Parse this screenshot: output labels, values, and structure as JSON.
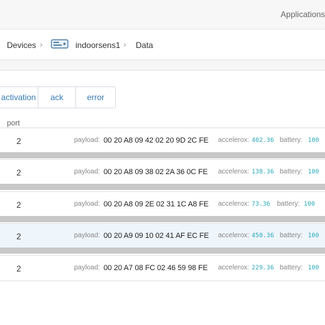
{
  "header": {
    "applications_label": "Applications"
  },
  "breadcrumb": {
    "devices": "Devices",
    "sep1": "›",
    "device": "indoorsens1",
    "sep2": "›",
    "data": "Data"
  },
  "tabs": [
    {
      "label": "activation"
    },
    {
      "label": "ack"
    },
    {
      "label": "error"
    }
  ],
  "table": {
    "port_header": "port",
    "payload_label": "payload:",
    "accelerox_label": "accelerox:",
    "battery_label": "battery:",
    "rows": [
      {
        "port": "2",
        "payload": "00 20 A8 09 42 02 20 9D 2C FE",
        "accelerox": "402.36",
        "battery": "100"
      },
      {
        "port": "2",
        "payload": "00 20 A8 09 38 02 2A 36 0C FE",
        "accelerox": "138.36",
        "battery": "100"
      },
      {
        "port": "2",
        "payload": "00 20 A8 09 2E 02 31 1C A8 FE",
        "accelerox": "73.36",
        "battery": "100"
      },
      {
        "port": "2",
        "payload": "00 20 A9 09 10 02 41 AF EC FE",
        "accelerox": "450.36",
        "battery": "100"
      },
      {
        "port": "2",
        "payload": "00 20 A7 08 FC 02 46 59 98 FE",
        "accelerox": "229.36",
        "battery": "100"
      }
    ]
  },
  "colors": {
    "link": "#337ab7",
    "value": "#2aa9b9",
    "row_highlight": "#eef5fb"
  }
}
